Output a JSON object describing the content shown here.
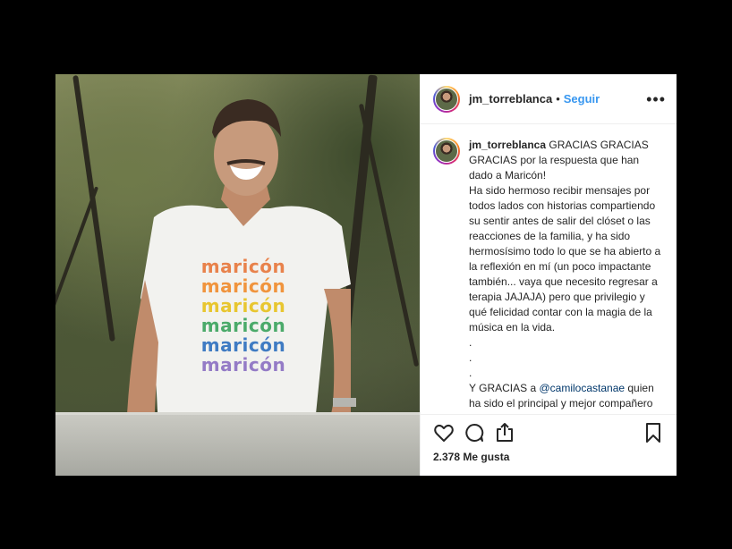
{
  "post": {
    "username": "jm_torreblanca",
    "separator": "•",
    "follow_label": "Seguir",
    "more_label": "•••",
    "caption_username": "jm_torreblanca",
    "caption_text_1": " GRACIAS GRACIAS GRACIAS por la respuesta que han dado a Maricón!\nHa sido hermoso recibir mensajes por todos lados con historias compartiendo su sentir antes de salir del clóset o las reacciones de la familia, y ha sido hermosísimo todo lo que se ha abierto a la reflexión en mí (un poco impactante también... vaya que necesito regresar a terapia JAJAJA) pero que privilegio y qué felicidad contar con la magia de la música en la vida.\n.\n.\n.\nY GRACIAS a ",
    "caption_mention": "@camilocastanae",
    "caption_text_2": " quien ha sido el principal y mejor compañero de camino en este",
    "likes": "2.378 Me gusta",
    "shirt_lines": [
      "maricón",
      "maricón",
      "maricón",
      "maricón",
      "maricón",
      "maricón"
    ]
  },
  "icons": {
    "like": "heart-icon",
    "comment": "comment-icon",
    "share": "share-icon",
    "save": "bookmark-icon"
  },
  "colors": {
    "follow": "#3897f0",
    "shirt": [
      "#e8763a",
      "#f08a2a",
      "#e8c21c",
      "#3aa35c",
      "#2c6fbf",
      "#8a6fc2"
    ]
  }
}
